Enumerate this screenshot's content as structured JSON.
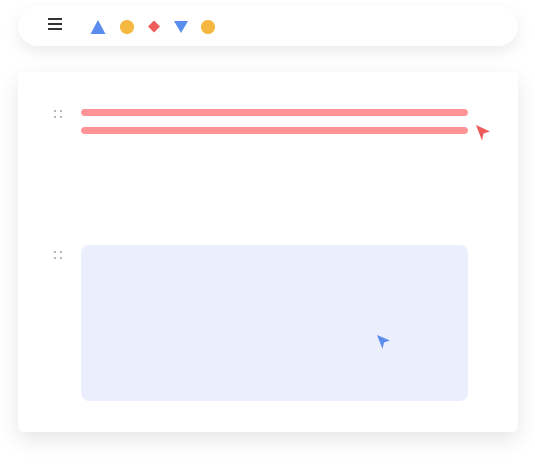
{
  "toolbar": {
    "menu_icon": "hamburger-menu-icon",
    "tools": [
      {
        "icon": "triangle-up-icon",
        "color": "#5B8DEF"
      },
      {
        "icon": "circle-icon",
        "color": "#F4B740"
      },
      {
        "icon": "diamond-icon",
        "color": "#EF5B5B"
      },
      {
        "icon": "triangle-down-icon",
        "color": "#5B8DEF"
      },
      {
        "icon": "circle-icon",
        "color": "#F4B740"
      }
    ]
  },
  "canvas": {
    "text_block": {
      "handle_icon": "drag-handle-icon",
      "line_color": "#FF9396",
      "line_count": 2,
      "cursor_icon": "red-pointer-cursor-icon",
      "cursor_color": "#EF5B5B"
    },
    "image_block": {
      "handle_icon": "drag-handle-icon",
      "fill_color": "#EBEFFD",
      "cursor_icon": "blue-pointer-cursor-icon",
      "cursor_color": "#5B8DEF"
    }
  }
}
